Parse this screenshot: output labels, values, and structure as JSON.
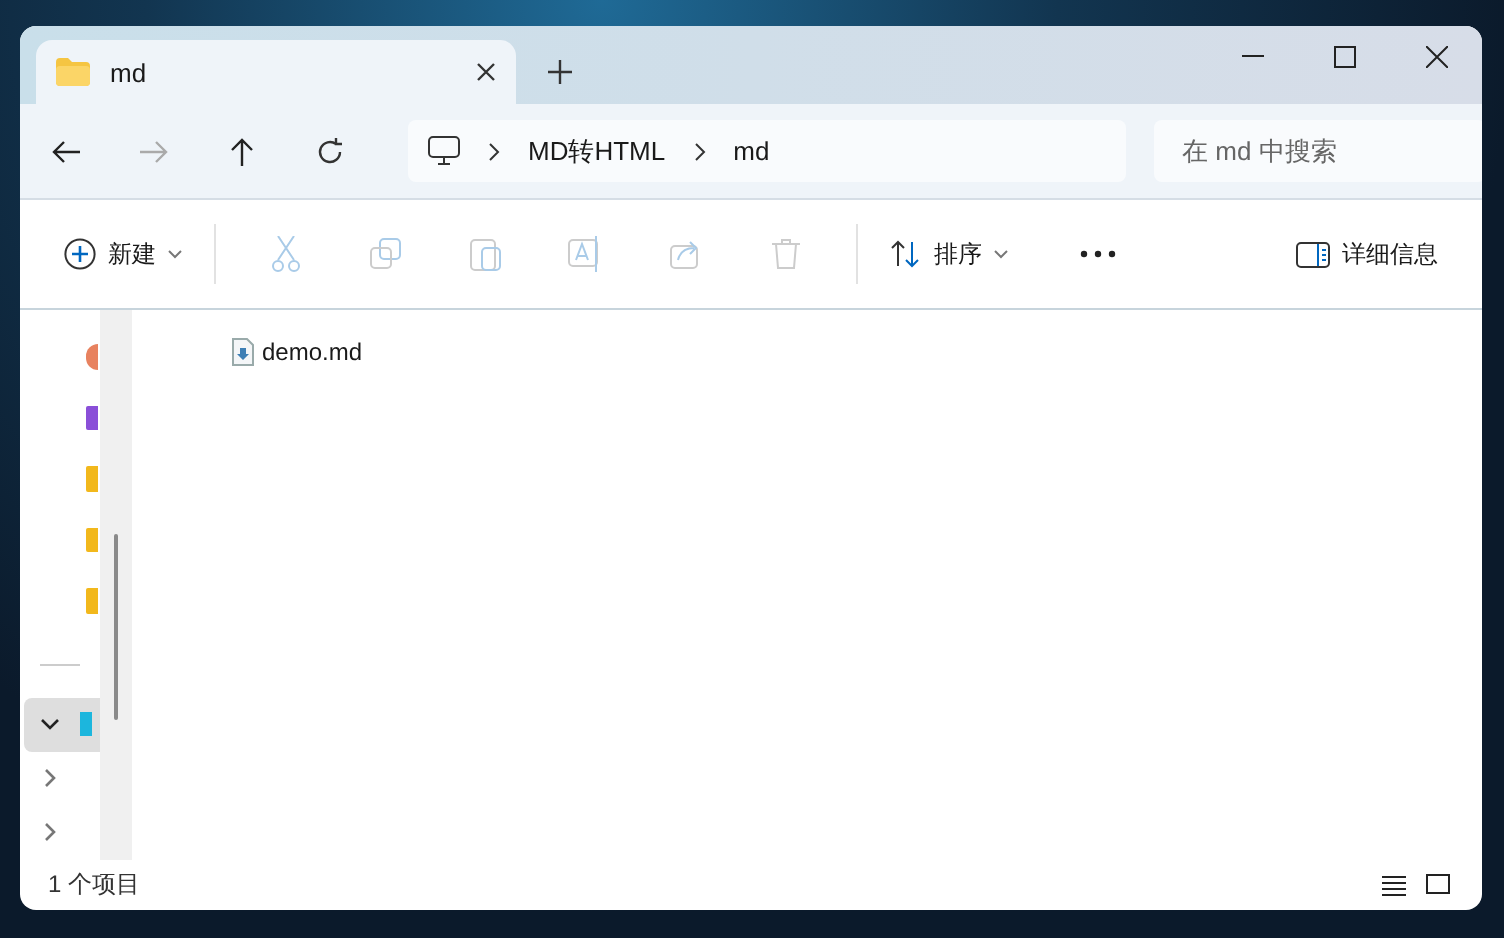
{
  "tabs": [
    {
      "label": "md",
      "selected": true
    }
  ],
  "address": {
    "segments": [
      "MD转HTML",
      "md"
    ]
  },
  "search": {
    "placeholder": "在 md 中搜索"
  },
  "toolbar": {
    "new_label": "新建",
    "sort_label": "排序",
    "details_label": "详细信息"
  },
  "sidebar": {
    "pinned": [
      {
        "color": "#e8825f"
      },
      {
        "color": "#8a4fd8"
      },
      {
        "color": "#f2b81c"
      },
      {
        "color": "#f2b81c"
      },
      {
        "color": "#f2b81c"
      }
    ],
    "tree": [
      {
        "expanded": true,
        "selected": true
      },
      {
        "expanded": false,
        "selected": false
      },
      {
        "expanded": false,
        "selected": false
      }
    ]
  },
  "files": [
    {
      "name": "demo.md"
    }
  ],
  "status_bar": {
    "count": "1 个项目"
  }
}
